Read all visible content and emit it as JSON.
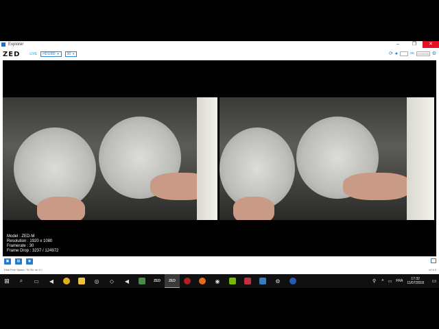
{
  "window": {
    "title": "Explorer",
    "controls": {
      "minimize": "–",
      "maximize": "❐",
      "close": "✕"
    }
  },
  "toolbar": {
    "brand": "ZED",
    "live_label": "LIVE",
    "resolution_select": "HD1080",
    "fps_select": "30",
    "right_label": "on",
    "right_box_text": "H1080/45"
  },
  "video": {
    "info": {
      "model": "Model : ZED-M",
      "resolution": "Resolution : 1920 x 1080",
      "framerate": "Framerate : 30",
      "frame_drop": "Frame Drop : 3237 / 124972"
    }
  },
  "bottom": {
    "free_space": "Disk Free Space: 76 Gb. on C:\\",
    "version": "v2.4.0"
  },
  "taskbar": {
    "language": "FRA",
    "time": "17:32",
    "date": "11/07/2018",
    "apps": [
      {
        "name": "search",
        "glyph": "⌕"
      },
      {
        "name": "task-view",
        "glyph": "▭"
      },
      {
        "name": "media",
        "glyph": "◀"
      },
      {
        "name": "chrome",
        "glyph": "●"
      },
      {
        "name": "files",
        "glyph": "▬"
      },
      {
        "name": "steam",
        "glyph": "◎"
      },
      {
        "name": "unity",
        "glyph": "◇"
      },
      {
        "name": "vs",
        "glyph": "◀"
      },
      {
        "name": "photos",
        "glyph": "▣"
      },
      {
        "name": "zed-explorer",
        "glyph": "ZED"
      },
      {
        "name": "zed-depth",
        "glyph": "ZED"
      },
      {
        "name": "app-red",
        "glyph": "●"
      },
      {
        "name": "firefox",
        "glyph": "●"
      },
      {
        "name": "vr",
        "glyph": "◉"
      },
      {
        "name": "nvidia",
        "glyph": "▣"
      },
      {
        "name": "app-paint",
        "glyph": "▣"
      },
      {
        "name": "app-monitor",
        "glyph": "▣"
      },
      {
        "name": "settings",
        "glyph": "⚙"
      },
      {
        "name": "app-blue",
        "glyph": "◉"
      }
    ]
  }
}
